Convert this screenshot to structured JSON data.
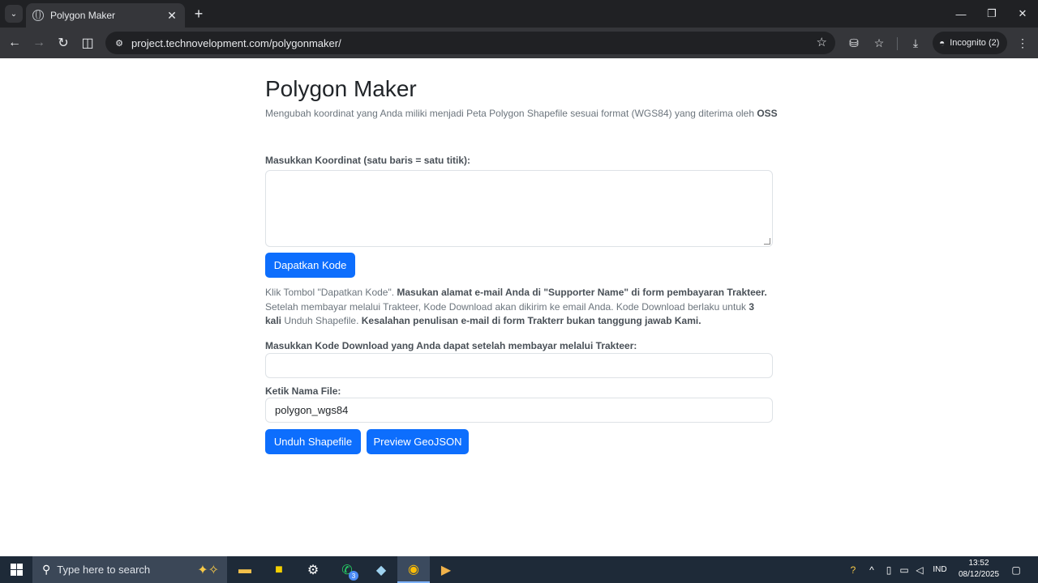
{
  "browser": {
    "tab_title": "Polygon Maker",
    "url": "project.technovelopment.com/polygonmaker/",
    "incognito_label": "Incognito (2)"
  },
  "page": {
    "title": "Polygon Maker",
    "subtitle": "Mengubah koordinat yang Anda miliki menjadi Peta Polygon Shapefile sesuai format (WGS84) yang diterima oleh",
    "subtitle_bold": "OSS",
    "coord_label": "Masukkan Koordinat (satu baris = satu titik):",
    "coord_value": "",
    "get_code_button": "Dapatkan Kode",
    "note": {
      "p1": "Klik Tombol \"Dapatkan Kode\". ",
      "b1": "Masukan alamat e-mail Anda di \"Supporter Name\" di form pembayaran Trakteer.",
      "p2": " Setelah membayar melalui Trakteer, Kode Download akan dikirim ke email Anda. Kode Download berlaku untuk ",
      "b2": "3 kali",
      "p3": " Unduh Shapefile. ",
      "b3": "Kesalahan penulisan e-mail di form Trakterr bukan tanggung jawab Kami."
    },
    "download_code_label": "Masukkan Kode Download yang Anda dapat setelah membayar melalui Trakteer:",
    "download_code_value": "",
    "filename_label": "Ketik Nama File:",
    "filename_value": "polygon_wgs84",
    "download_button": "Unduh Shapefile",
    "preview_button": "Preview GeoJSON"
  },
  "taskbar": {
    "search_placeholder": "Type here to search",
    "whatsapp_badge": "3",
    "language": "IND",
    "time": "13:52",
    "date": "08/12/2025"
  },
  "colors": {
    "primary": "#0d6efd",
    "chrome_dark": "#202124",
    "chrome_toolbar": "#35363a",
    "taskbar": "#1e2a38"
  }
}
